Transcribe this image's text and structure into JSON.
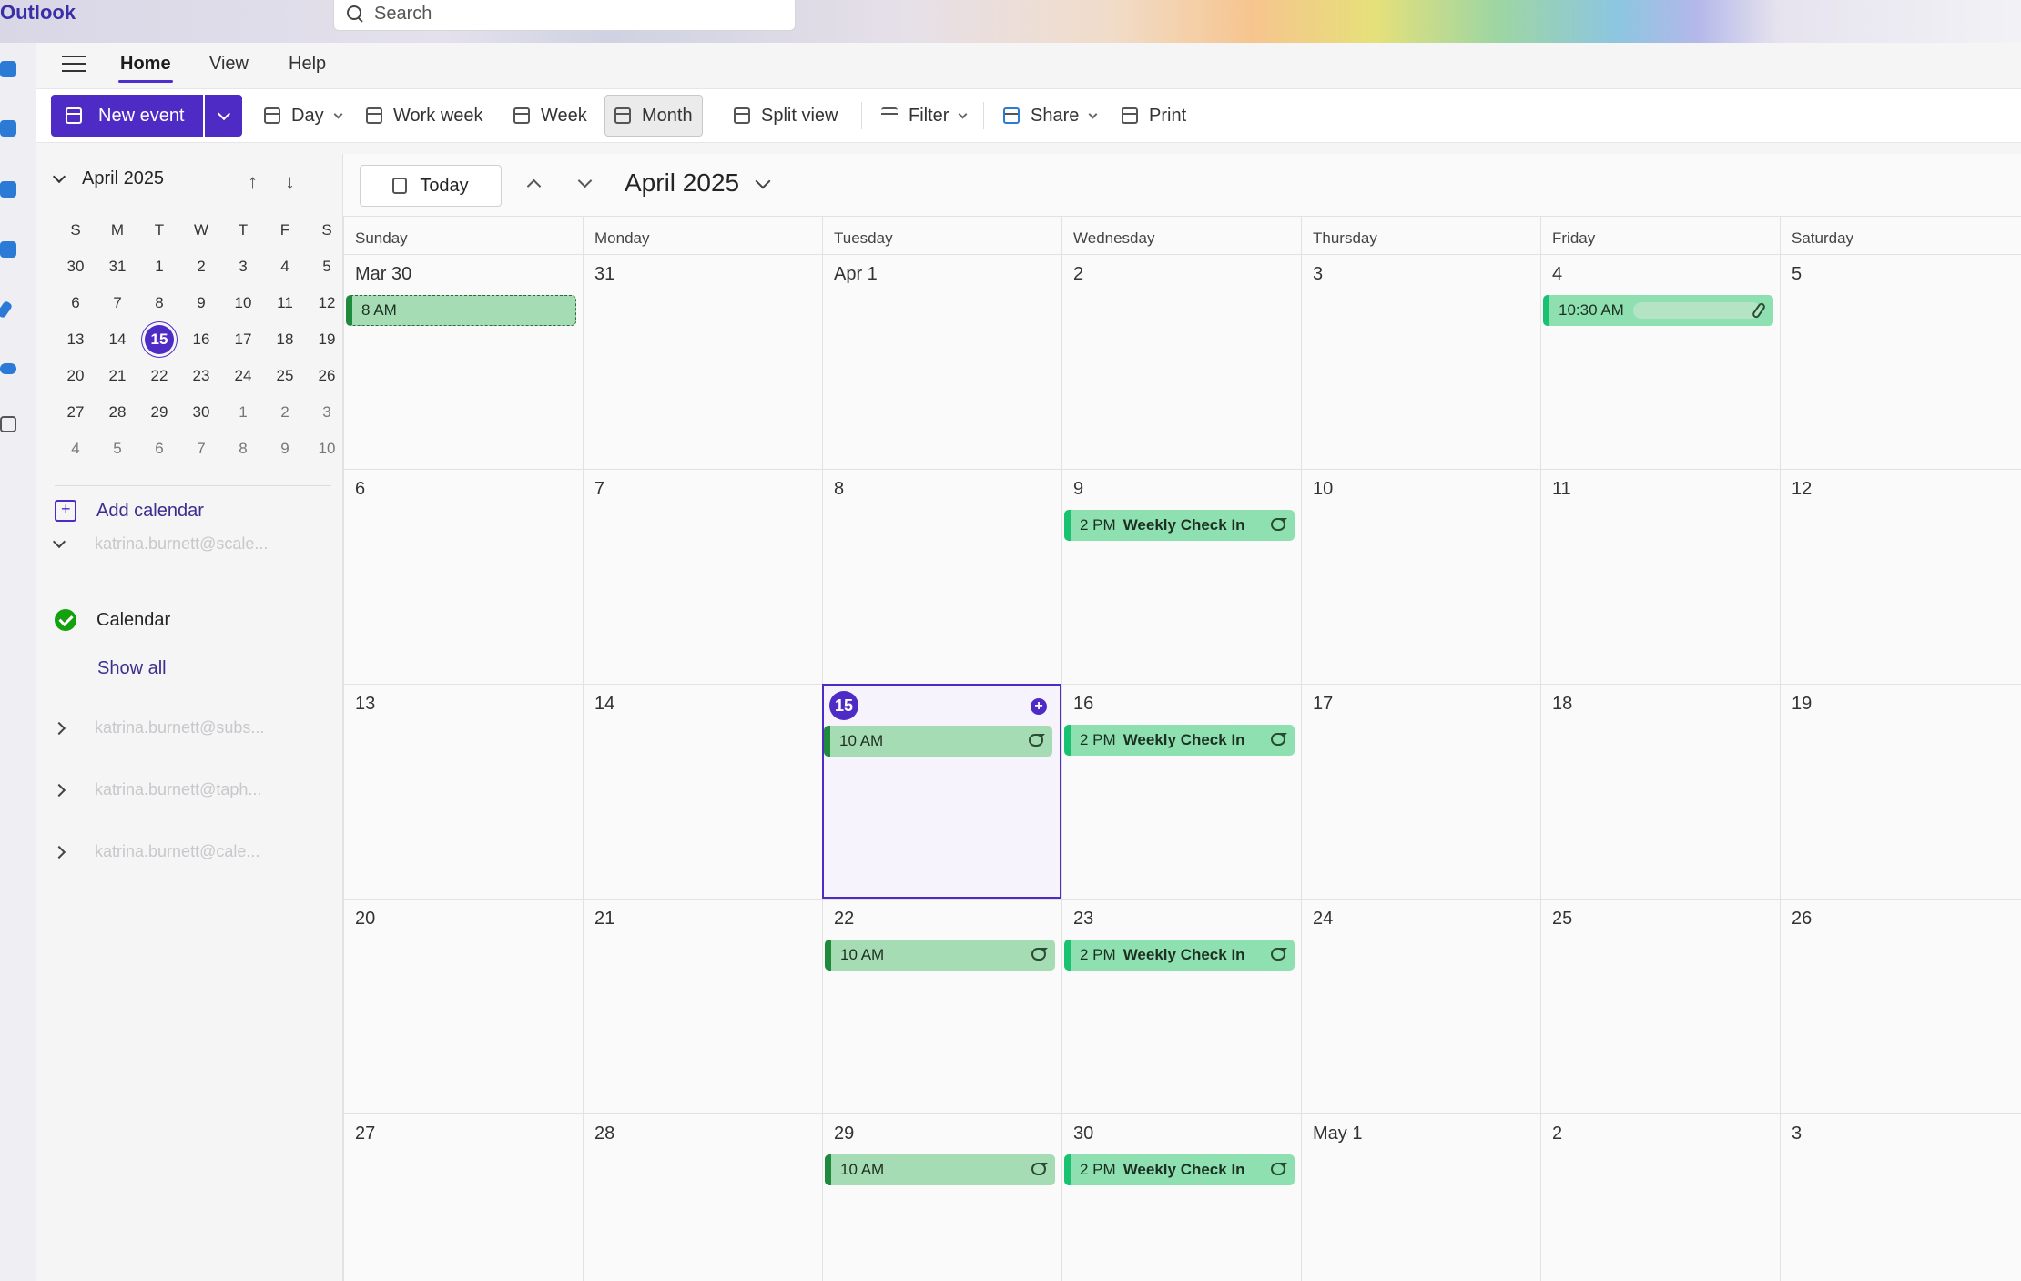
{
  "app": {
    "brand": "Outlook"
  },
  "search": {
    "placeholder": "Search"
  },
  "ribbon_tabs": [
    "Home",
    "View",
    "Help"
  ],
  "toolbar": {
    "new_event": "New event",
    "day": "Day",
    "work_week": "Work week",
    "week": "Week",
    "month": "Month",
    "split_view": "Split view",
    "filter": "Filter",
    "share": "Share",
    "print": "Print"
  },
  "mini_calendar": {
    "title": "April 2025",
    "weekdays": [
      "S",
      "M",
      "T",
      "W",
      "T",
      "F",
      "S"
    ],
    "weeks": [
      [
        "30",
        "31",
        "1",
        "2",
        "3",
        "4",
        "5"
      ],
      [
        "6",
        "7",
        "8",
        "9",
        "10",
        "11",
        "12"
      ],
      [
        "13",
        "14",
        "15",
        "16",
        "17",
        "18",
        "19"
      ],
      [
        "20",
        "21",
        "22",
        "23",
        "24",
        "25",
        "26"
      ],
      [
        "27",
        "28",
        "29",
        "30",
        "1",
        "2",
        "3"
      ],
      [
        "4",
        "5",
        "6",
        "7",
        "8",
        "9",
        "10"
      ]
    ],
    "today": "15"
  },
  "sidebar": {
    "add_calendar": "Add calendar",
    "accounts": [
      "katrina.burnett@scale...",
      "katrina.burnett@subs...",
      "katrina.burnett@taph...",
      "katrina.burnett@cale..."
    ],
    "calendar_item": "Calendar",
    "show_all": "Show all"
  },
  "main": {
    "today_label": "Today",
    "month_title": "April 2025",
    "weekday_headers": [
      "Sunday",
      "Monday",
      "Tuesday",
      "Wednesday",
      "Thursday",
      "Friday",
      "Saturday"
    ],
    "weeks": [
      [
        "Mar 30",
        "31",
        "Apr 1",
        "2",
        "3",
        "4",
        "5"
      ],
      [
        "6",
        "7",
        "8",
        "9",
        "10",
        "11",
        "12"
      ],
      [
        "13",
        "14",
        "15",
        "16",
        "17",
        "18",
        "19"
      ],
      [
        "20",
        "21",
        "22",
        "23",
        "24",
        "25",
        "26"
      ],
      [
        "27",
        "28",
        "29",
        "30",
        "May 1",
        "2",
        "3"
      ]
    ],
    "events": {
      "mar30": {
        "time": "8 AM",
        "title": ""
      },
      "apr4": {
        "time": "10:30 AM",
        "title": ""
      },
      "weekly": {
        "time": "2 PM",
        "title": "Weekly Check In"
      },
      "tuesday": {
        "time": "10 AM",
        "title": ""
      }
    }
  },
  "colors": {
    "accent": "#4f2bc6",
    "event_green": "#a6dcb4",
    "event_mint": "#8ee0b0"
  }
}
